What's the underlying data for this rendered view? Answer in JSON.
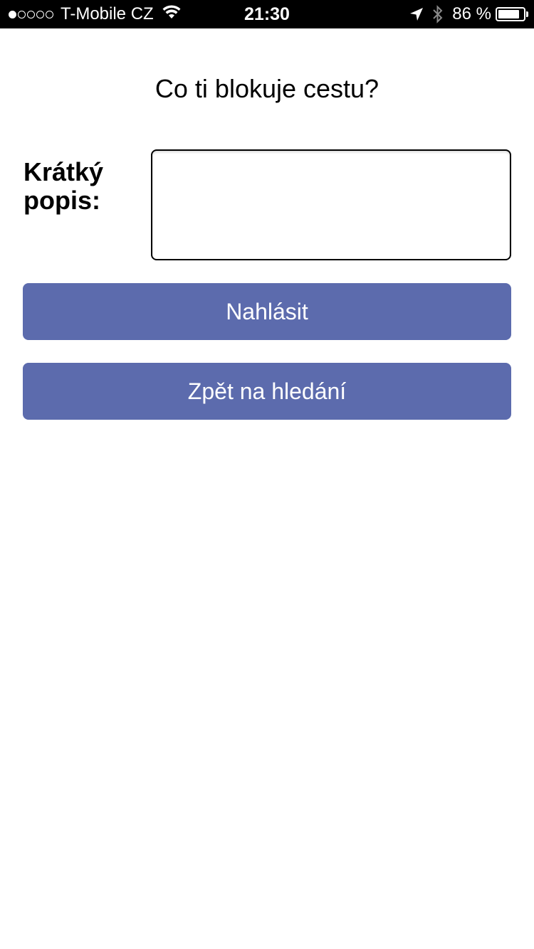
{
  "status_bar": {
    "signal_bars_filled": 1,
    "signal_bars_total": 5,
    "carrier": "T-Mobile CZ",
    "wifi_icon": "wifi-icon",
    "time": "21:30",
    "location_icon": "location-arrow-icon",
    "bluetooth_icon": "bluetooth-icon",
    "battery_text": "86 %",
    "battery_level": 0.86
  },
  "page": {
    "title": "Co ti blokuje cestu?"
  },
  "form": {
    "description_label": "Krátký popis:",
    "description_value": "",
    "description_placeholder": ""
  },
  "buttons": {
    "report_label": "Nahlásit",
    "back_label": "Zpět na hledání"
  },
  "colors": {
    "button_bg": "#5c6bad",
    "button_text": "#ffffff",
    "status_bar_bg": "#000000"
  }
}
